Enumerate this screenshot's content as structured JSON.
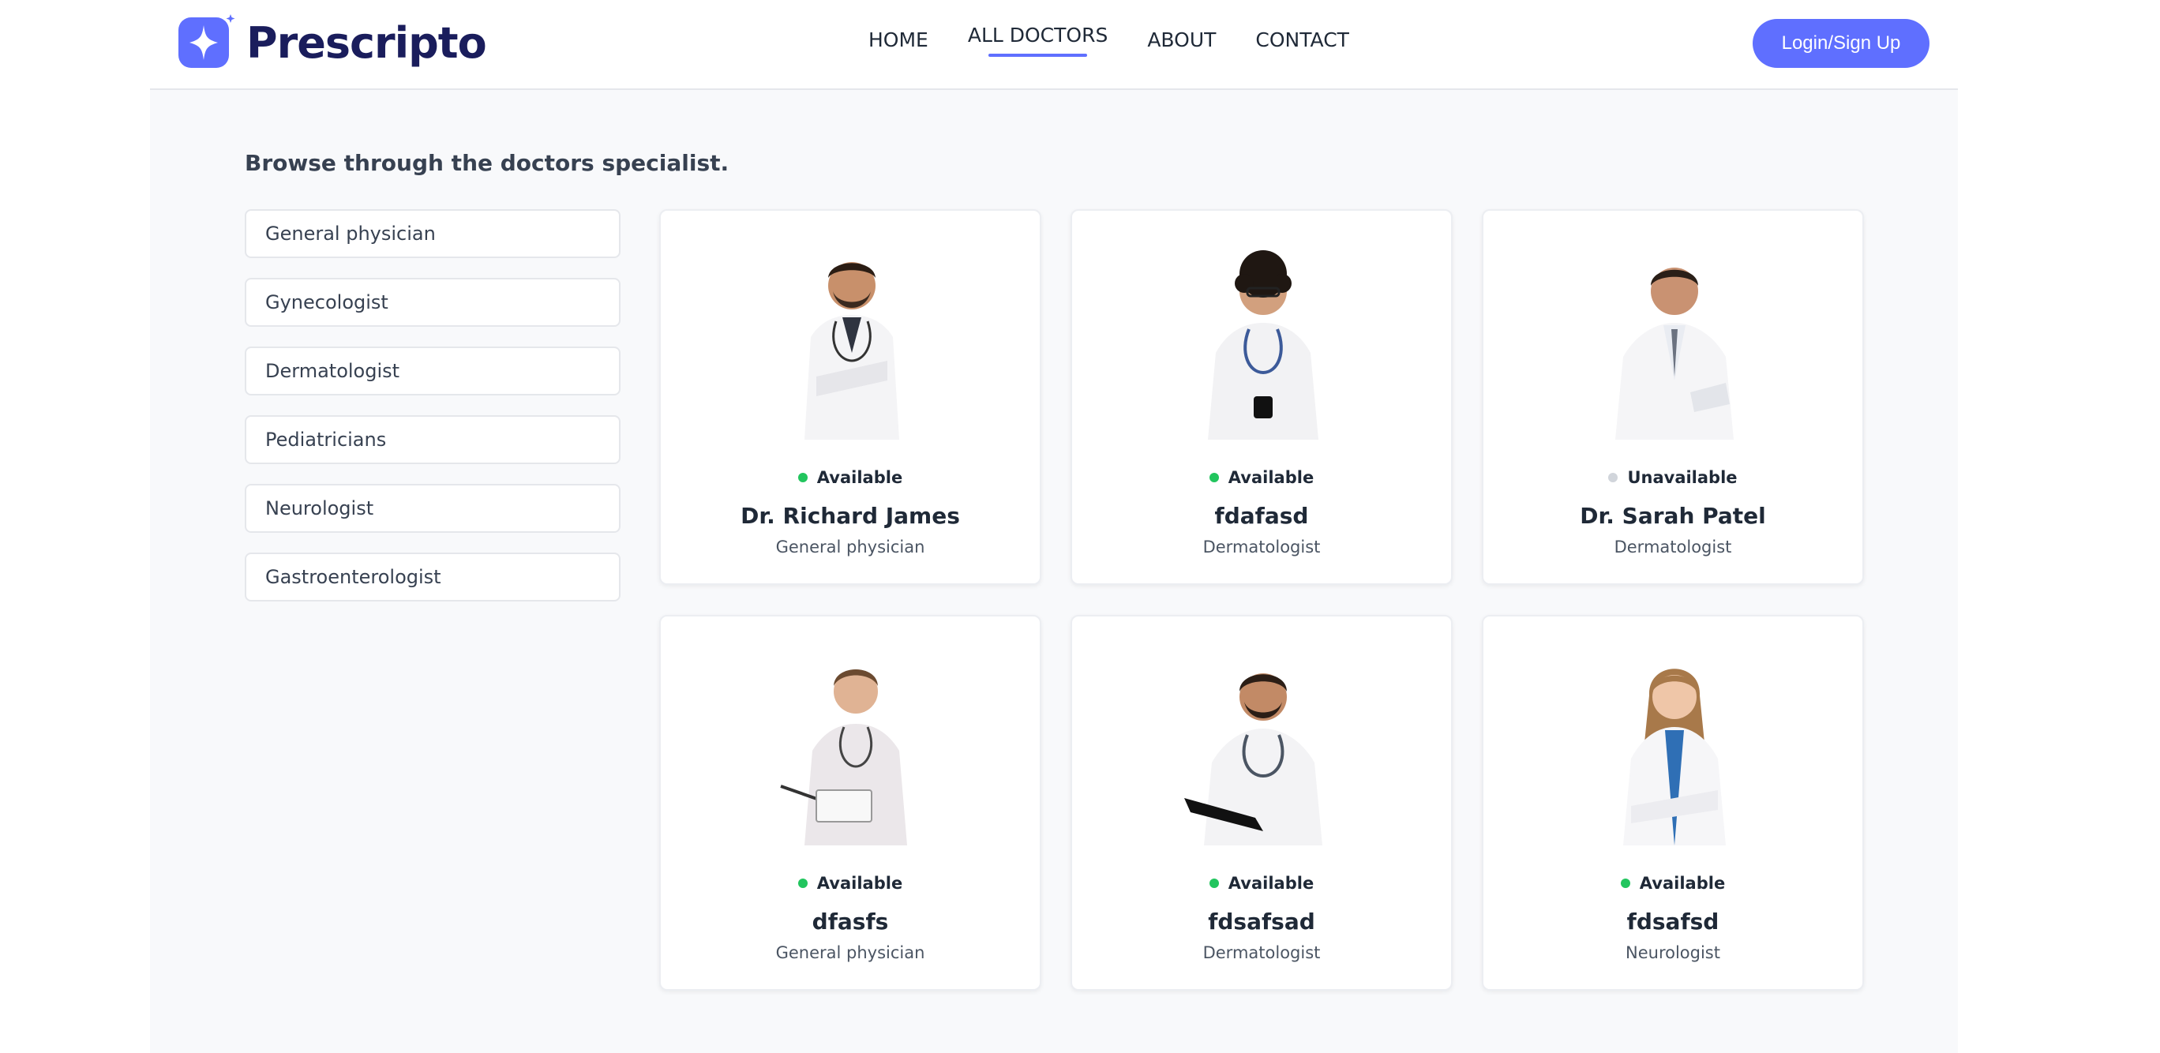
{
  "brand": {
    "name": "Prescripto",
    "color": "#5f6fff"
  },
  "nav": {
    "items": [
      {
        "label": "HOME",
        "active": false
      },
      {
        "label": "ALL DOCTORS",
        "active": true
      },
      {
        "label": "ABOUT",
        "active": false
      },
      {
        "label": "CONTACT",
        "active": false
      }
    ],
    "login_label": "Login/Sign Up"
  },
  "main": {
    "heading": "Browse through the doctors specialist.",
    "filters": [
      "General physician",
      "Gynecologist",
      "Dermatologist",
      "Pediatricians",
      "Neurologist",
      "Gastroenterologist"
    ],
    "doctors": [
      {
        "name": "Dr. Richard James",
        "speciality": "General physician",
        "status": "Available",
        "available": true,
        "photo_icon": "doctor-photo"
      },
      {
        "name": "fdafasd",
        "speciality": "Dermatologist",
        "status": "Available",
        "available": true,
        "photo_icon": "doctor-photo"
      },
      {
        "name": "Dr. Sarah Patel",
        "speciality": "Dermatologist",
        "status": "Unavailable",
        "available": false,
        "photo_icon": "doctor-photo"
      },
      {
        "name": "dfasfs",
        "speciality": "General physician",
        "status": "Available",
        "available": true,
        "photo_icon": "doctor-photo"
      },
      {
        "name": "fdsafsad",
        "speciality": "Dermatologist",
        "status": "Available",
        "available": true,
        "photo_icon": "doctor-photo"
      },
      {
        "name": "fdsafsd",
        "speciality": "Neurologist",
        "status": "Available",
        "available": true,
        "photo_icon": "doctor-photo"
      }
    ]
  },
  "colors": {
    "available": "#22c55e",
    "unavailable": "#d1d5db",
    "accent": "#5f6fff"
  }
}
